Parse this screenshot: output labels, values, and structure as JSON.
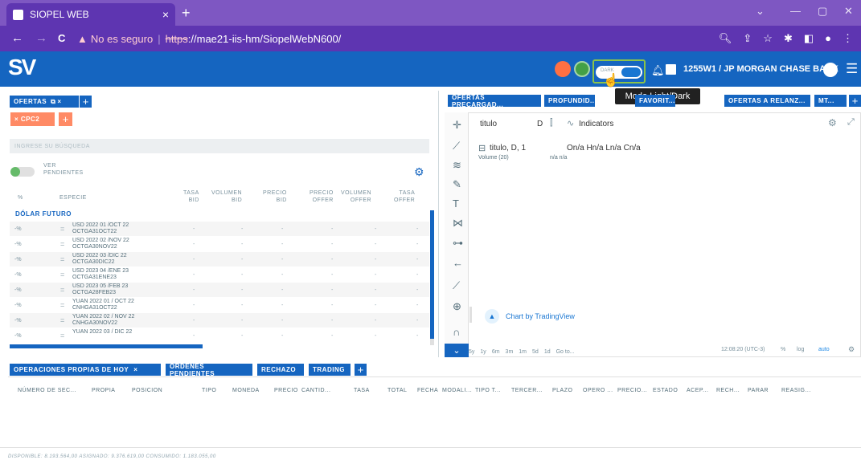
{
  "browser": {
    "tab_title": "SIOPEL WEB",
    "tab_close": "×",
    "new_tab": "+",
    "win_min": "—",
    "win_max": "▢",
    "win_close": "✕",
    "win_chev": "⌄",
    "back": "←",
    "forward": "→",
    "reload": "C",
    "warn": "▲",
    "not_secure": "No es seguro",
    "sep": "|",
    "url_scheme": "https",
    "url_rest": "://mae21-iis-hm/SiopelWebN600/"
  },
  "header": {
    "logo": "SV",
    "toggle_label": "DARK",
    "tooltip": "Modo Light/Dark",
    "bank": "1255W1 / JP MORGAN CHASE BANK",
    "menu": "☰"
  },
  "offers": {
    "tab": "OFERTAS",
    "tab_close": "×",
    "plus": "+",
    "chip": "× CPC2",
    "search_placeholder": "INGRESE SU BÚSQUEDA",
    "ver": "VER",
    "pendientes": "PENDIENTES",
    "col_pct": "%",
    "col_especie": "ESPECIE",
    "col_tasa_bid": [
      "TASA",
      "BID"
    ],
    "col_vol_bid": [
      "VOLUMEN",
      "BID"
    ],
    "col_precio_bid": [
      "PRECIO",
      "BID"
    ],
    "col_precio_offer": [
      "PRECIO",
      "OFFER"
    ],
    "col_vol_offer": [
      "VOLUMEN",
      "OFFER"
    ],
    "col_tasa_offer": [
      "TASA",
      "OFFER"
    ],
    "group": "DÓLAR FUTURO",
    "rows": [
      {
        "pct": "-%",
        "l1": "USD 2022 01 /OCT 22",
        "l2": "OCTGA31OCT22"
      },
      {
        "pct": "-%",
        "l1": "USD 2022 02 /NOV 22",
        "l2": "OCTGA30NOV22"
      },
      {
        "pct": "-%",
        "l1": "USD 2022 03 /DIC 22",
        "l2": "OCTGA30DIC22"
      },
      {
        "pct": "-%",
        "l1": "USD 2023 04 /ENE 23",
        "l2": "OCTGA31ENE23"
      },
      {
        "pct": "-%",
        "l1": "USD 2023 05 /FEB 23",
        "l2": "OCTGA28FEB23"
      },
      {
        "pct": "-%",
        "l1": "YUAN 2022 01 / OCT 22",
        "l2": "CNHGA31OCT22"
      },
      {
        "pct": "-%",
        "l1": "YUAN 2022 02 / NOV 22",
        "l2": "CNHGA30NOV22"
      },
      {
        "pct": "-%",
        "l1": "YUAN 2022 03 / DIC 22",
        "l2": ""
      }
    ],
    "dash": "-"
  },
  "chart": {
    "tabs": [
      "OFERTAS PRECARGAD...",
      "PROFUNDID...",
      "FAVORIT...",
      "OFERTAS A RELANZ...",
      "MT..."
    ],
    "plus": "+",
    "symbol": "titulo",
    "interval": "D",
    "indicators": "Indicators",
    "legend1": "titulo, D, 1",
    "legend1_vals": "On/a Hn/a Ln/a Cn/a",
    "legend2": "Volume (20)",
    "legend2_vals": "n/a  n/a",
    "attribution": "Chart by TradingView",
    "ranges": [
      "5y",
      "1y",
      "6m",
      "3m",
      "1m",
      "5d",
      "1d",
      "Go to..."
    ],
    "time": "12:08:20 (UTC-3)",
    "pct": "%",
    "log": "log",
    "auto": "auto"
  },
  "ops": {
    "tabs": [
      "OPERACIONES PROPIAS DE HOY",
      "ORDENES PENDIENTES",
      "RECHAZO",
      "TRADING"
    ],
    "tab_close": "×",
    "plus": "+",
    "columns": [
      "NÚMERO DE SEC...",
      "PROPIA",
      "POSICION",
      "TIPO",
      "MONEDA",
      "PRECIO",
      "CANTID...",
      "TASA",
      "TOTAL",
      "FECHA",
      "MODALI...",
      "TIPO T...",
      "TERCER...",
      "PLAZO",
      "OPERO ...",
      "PRECIO...",
      "ESTADO",
      "ACEP...",
      "RECH...",
      "PARAR",
      "REASIG..."
    ]
  },
  "footer": "DISPONIBLE: 8.193.564,00   ASIGNADO: 9.376.619,00   CONSUMIDO: 1.183.055,00"
}
